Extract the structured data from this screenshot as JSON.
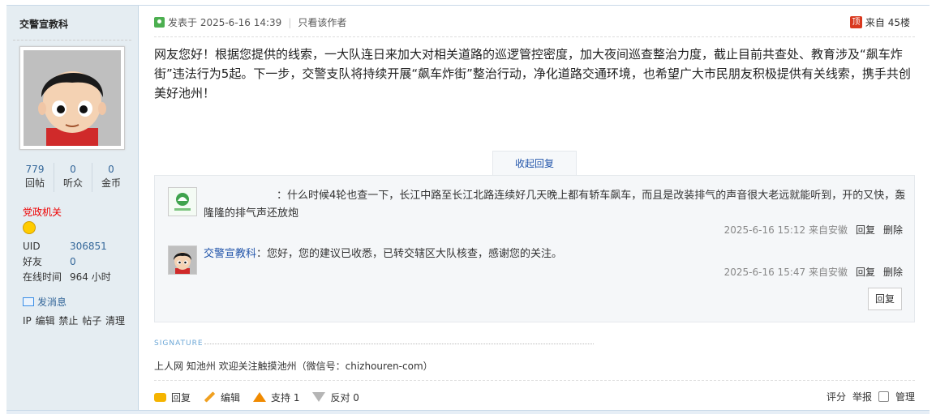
{
  "user": {
    "name": "交警宣教科",
    "stats": [
      {
        "value": "779",
        "label": "回帖"
      },
      {
        "value": "0",
        "label": "听众"
      },
      {
        "value": "0",
        "label": "金币"
      }
    ],
    "group": "党政机关",
    "info": [
      {
        "key": "UID",
        "value": "306851"
      },
      {
        "key": "好友",
        "value": "0"
      },
      {
        "key": "在线时间",
        "value": "964 小时"
      }
    ],
    "send_message": "发消息",
    "admin_links": "IP 编辑 禁止 帖子 清理"
  },
  "post": {
    "posted_at": "发表于 2025-6-16 14:39",
    "author_only": "只看该作者",
    "floor_icon": "顶",
    "floor": "来自 45楼",
    "content": "网友您好！根据您提供的线索，一大队连日来加大对相关道路的巡逻管控密度，加大夜间巡查整治力度，截止目前共查处、教育涉及“飙车炸街”违法行为5起。下一步，交警支队将持续开展“飙车炸街”整治行动，净化道路交通环境，也希望广大市民朋友积极提供有关线索，携手共创美好池州！"
  },
  "comments": {
    "fold_label": "收起回复",
    "items": [
      {
        "author": "",
        "text": "：什么时候4轮也查一下，长江中路至长江北路连续好几天晚上都有轿车飙车，而且是改装排气的声音很大老远就能听到，开的又快，轰隆隆的排气声还放炮",
        "time": "2025-6-16 15:12 来自安徽",
        "reply": "回复",
        "delete": "删除"
      },
      {
        "author": "交警宣教科",
        "text": "：您好，您的建议已收悉，已转交辖区大队核查，感谢您的关注。",
        "time": "2025-6-16 15:47 来自安徽",
        "reply": "回复",
        "delete": "删除"
      }
    ],
    "reply_button": "回复"
  },
  "signature": {
    "label": "SIGNATURE",
    "text": "上人网 知池州 欢迎关注触摸池州（微信号：chizhouren-com）"
  },
  "footer": {
    "reply": "回复",
    "edit": "编辑",
    "support": "支持 1",
    "oppose": "反对 0",
    "rate": "评分",
    "report": "举报",
    "manage": "管理"
  }
}
